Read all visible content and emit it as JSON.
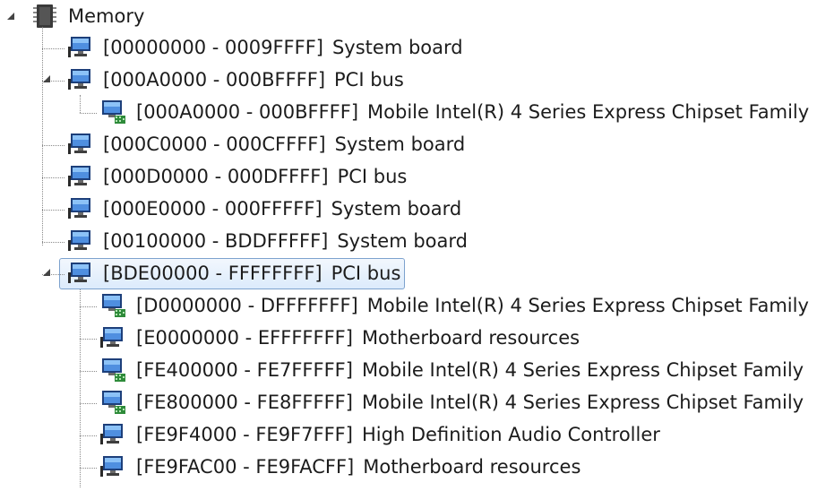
{
  "tree": {
    "root": {
      "label": "Memory",
      "icon": "memory-chip-icon",
      "expanded": true
    },
    "items": [
      {
        "address": "[00000000 - 0009FFFF]",
        "name": "System board",
        "icon": "monitor-icon",
        "level": 1,
        "expander": "none"
      },
      {
        "address": "[000A0000 - 000BFFFF]",
        "name": "PCI bus",
        "icon": "monitor-icon",
        "level": 1,
        "expander": "expanded"
      },
      {
        "address": "[000A0000 - 000BFFFF]",
        "name": "Mobile Intel(R) 4 Series Express Chipset Family",
        "icon": "display-adapter-icon",
        "level": 2,
        "expander": "none"
      },
      {
        "address": "[000C0000 - 000CFFFF]",
        "name": "System board",
        "icon": "monitor-icon",
        "level": 1,
        "expander": "none"
      },
      {
        "address": "[000D0000 - 000DFFFF]",
        "name": "PCI bus",
        "icon": "monitor-icon",
        "level": 1,
        "expander": "none"
      },
      {
        "address": "[000E0000 - 000FFFFF]",
        "name": "System board",
        "icon": "monitor-icon",
        "level": 1,
        "expander": "none"
      },
      {
        "address": "[00100000 - BDDFFFFF]",
        "name": "System board",
        "icon": "monitor-icon",
        "level": 1,
        "expander": "none"
      },
      {
        "address": "[BDE00000 - FFFFFFFF]",
        "name": "PCI bus",
        "icon": "monitor-icon",
        "level": 1,
        "expander": "expanded",
        "selected": true
      },
      {
        "address": "[D0000000 - DFFFFFFF]",
        "name": "Mobile Intel(R) 4 Series Express Chipset Family",
        "icon": "display-adapter-icon",
        "level": 2,
        "expander": "none"
      },
      {
        "address": "[E0000000 - EFFFFFFF]",
        "name": "Motherboard resources",
        "icon": "monitor-icon",
        "level": 2,
        "expander": "none"
      },
      {
        "address": "[FE400000 - FE7FFFFF]",
        "name": "Mobile Intel(R) 4 Series Express Chipset Family",
        "icon": "display-adapter-icon",
        "level": 2,
        "expander": "none"
      },
      {
        "address": "[FE800000 - FE8FFFFF]",
        "name": "Mobile Intel(R) 4 Series Express Chipset Family",
        "icon": "display-adapter-icon",
        "level": 2,
        "expander": "none"
      },
      {
        "address": "[FE9F4000 - FE9F7FFF]",
        "name": "High Definition Audio Controller",
        "icon": "monitor-icon",
        "level": 2,
        "expander": "none"
      },
      {
        "address": "[FE9FAC00 - FE9FACFF]",
        "name": "Motherboard resources",
        "icon": "monitor-icon",
        "level": 2,
        "expander": "none"
      }
    ]
  },
  "colors": {
    "selection_border": "#7da2ce",
    "selection_fill": "#dcebfc",
    "text": "#1c1c1c"
  }
}
